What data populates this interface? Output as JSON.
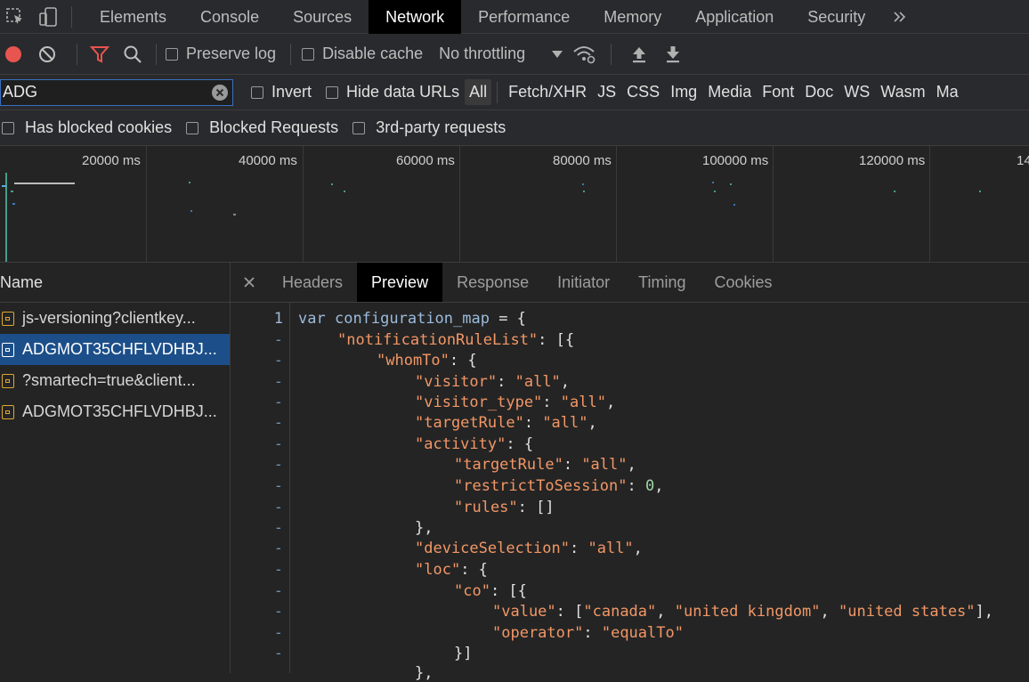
{
  "tabs": [
    "Elements",
    "Console",
    "Sources",
    "Network",
    "Performance",
    "Memory",
    "Application",
    "Security"
  ],
  "active_tab": "Network",
  "controls": {
    "preserve_log": "Preserve log",
    "disable_cache": "Disable cache",
    "throttling": "No throttling"
  },
  "filter": {
    "value": "ADG",
    "invert": "Invert",
    "hide_data_urls": "Hide data URLs",
    "types": [
      "All",
      "Fetch/XHR",
      "JS",
      "CSS",
      "Img",
      "Media",
      "Font",
      "Doc",
      "WS",
      "Wasm",
      "Ma"
    ],
    "active_type": "All"
  },
  "blocked": {
    "has_blocked_cookies": "Has blocked cookies",
    "blocked_requests": "Blocked Requests",
    "third_party": "3rd-party requests"
  },
  "timeline": {
    "ticks": [
      "20000 ms",
      "40000 ms",
      "60000 ms",
      "80000 ms",
      "100000 ms",
      "120000 ms",
      "14"
    ]
  },
  "requests": {
    "header": "Name",
    "items": [
      {
        "name": "js-versioning?clientkey...",
        "selected": false
      },
      {
        "name": "ADGMOT35CHFLVDHBJ...",
        "selected": true
      },
      {
        "name": "?smartech=true&client...",
        "selected": false
      },
      {
        "name": "ADGMOT35CHFLVDHBJ...",
        "selected": false
      }
    ]
  },
  "detail": {
    "tabs": [
      "Headers",
      "Preview",
      "Response",
      "Initiator",
      "Timing",
      "Cookies"
    ],
    "active_tab": "Preview",
    "first_line_number": "1",
    "continuation_marker": "-",
    "code": {
      "l1_kw": "var",
      "l1_name": "configuration_map",
      "l1_rest": " = {",
      "notificationRuleList": "\"notificationRuleList\"",
      "whomTo": "\"whomTo\"",
      "visitor": "\"visitor\"",
      "visitor_type": "\"visitor_type\"",
      "targetRule": "\"targetRule\"",
      "activity": "\"activity\"",
      "restrictToSession": "\"restrictToSession\"",
      "rules": "\"rules\"",
      "deviceSelection": "\"deviceSelection\"",
      "loc": "\"loc\"",
      "co": "\"co\"",
      "value": "\"value\"",
      "operator": "\"operator\"",
      "all": "\"all\"",
      "zero": "0",
      "canada": "\"canada\"",
      "uk": "\"united kingdom\"",
      "us": "\"united states\"",
      "equalTo": "\"equalTo\""
    }
  },
  "colors": {
    "record": "#e8544f",
    "filter_active": "#e8544f",
    "selected_row": "#1c4f8a",
    "string": "#f29766",
    "key": "#9bbbdc",
    "number": "#9ed6a4"
  }
}
